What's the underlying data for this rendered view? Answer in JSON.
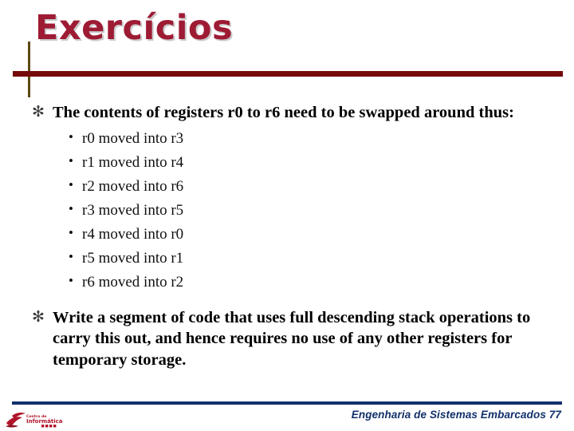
{
  "slide": {
    "title": "Exercícios",
    "blocks": [
      {
        "marker": "✻",
        "text": "The contents of registers r0 to r6 need to be swapped around thus:",
        "sub_marker": "•",
        "sub_items": [
          "r0 moved into r3",
          "r1 moved into r4",
          "r2 moved into r6",
          "r3 moved into r5",
          "r4 moved into r0",
          "r5 moved into r1",
          "r6 moved into r2"
        ]
      },
      {
        "marker": "✻",
        "text": "Write a segment of code that uses full descending stack operations to carry this out, and hence requires no use of any other registers for temporary storage.",
        "sub_marker": "•",
        "sub_items": []
      }
    ]
  },
  "footer": {
    "text": "Engenharia de Sistemas Embarcados 77",
    "course": "Engenharia de Sistemas Embarcados",
    "page_number": "77",
    "logo_line1": "Centro de",
    "logo_line2": "Informática",
    "logo_line3": "U F P E"
  },
  "colors": {
    "title": "#9e1b34",
    "title_shadow": "#c9c9c9",
    "title_rule": "#750a0a",
    "title_vrule": "#5c4a14",
    "footer_rule": "#12306b",
    "footer_text": "#12306b",
    "logo_red": "#b0142b",
    "background": "#ffffff",
    "body_text": "#000000"
  }
}
